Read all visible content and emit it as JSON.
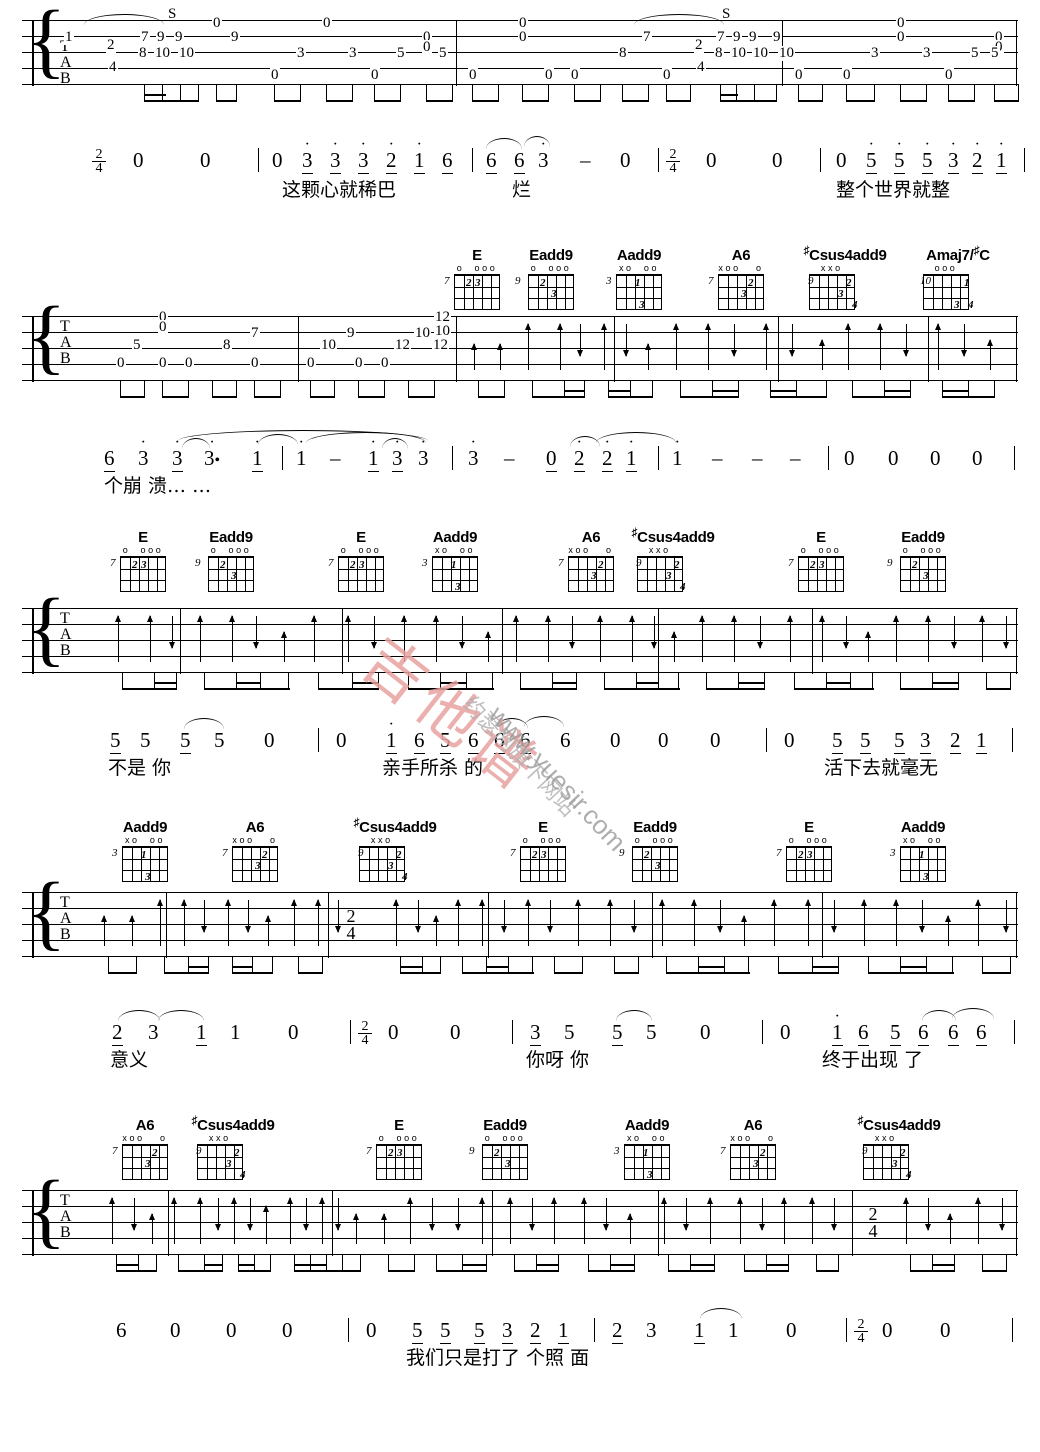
{
  "document": {
    "type": "guitar-tablature",
    "notation": "TAB + jianpu numbered notation with Chinese lyrics",
    "tab_letters": [
      "T",
      "A",
      "B"
    ]
  },
  "watermark": {
    "chinese": "吉他谱",
    "site_chinese": "约瑟网旗下网站",
    "url": "www.yuesir.com",
    "color_red": "#e8a3a0",
    "color_gray": "#9a9a9a"
  },
  "meter": {
    "num": "2",
    "den": "4"
  },
  "chord_names": {
    "E": "E",
    "Eadd9": "Eadd9",
    "Aadd9": "Aadd9",
    "A6": "A6",
    "Csus4add9": "Csus4add9",
    "Csus4add9_sharp": "♯",
    "Amaj7C": "Amaj7/",
    "Amaj7C_sharp": "♯",
    "Amaj7C_bass": "C"
  },
  "systems": [
    {
      "id": "system-1",
      "chords": [],
      "tab_numbers": [
        "1",
        "2",
        "7",
        "9",
        "9",
        "8",
        "10",
        "10",
        "0",
        "9",
        "4",
        "0",
        "0",
        "3",
        "0",
        "3",
        "0",
        "5",
        "0",
        "5",
        "0",
        "0",
        "8",
        "7",
        "0",
        "0",
        "0",
        "2",
        "7",
        "9",
        "9",
        "9",
        "8",
        "10",
        "10",
        "10",
        "0",
        "0",
        "0",
        "0",
        "3",
        "0",
        "3",
        "0",
        "5",
        "0",
        "5"
      ],
      "markings": [
        "S",
        "S"
      ],
      "jianpu": "2/4  0  0 | 0  3 3 3 2 1 6 | 6 6 3 - 0 | 2/4 0 0 | 0 5 5 5 3 2 1 |",
      "lyrics": [
        "这颗心就稀巴",
        "烂",
        "整个世界就整"
      ]
    },
    {
      "id": "system-2",
      "chords": [
        "E",
        "Eadd9",
        "Aadd9",
        "A6",
        "♯Csus4add9",
        "Amaj7/♯C"
      ],
      "tab_numbers": [
        "0",
        "0",
        "5",
        "7",
        "8",
        "0",
        "0",
        "10",
        "9",
        "0",
        "0",
        "12",
        "10",
        "10",
        "12",
        "12",
        "12",
        "0"
      ],
      "jianpu": "6 3 3 3· 1 | 1 - 1 3 3 | 3 - 0 2 2 1 | 1 - - - | 0 0 0 0 |",
      "lyrics": [
        "个崩 溃… …"
      ]
    },
    {
      "id": "system-3",
      "chords": [
        "E",
        "Eadd9",
        "E",
        "Aadd9",
        "A6",
        "♯Csus4add9",
        "E",
        "Eadd9"
      ],
      "tab_numbers": [],
      "jianpu": "5 5 5 5 0 | 0 1 6 5 6 6 6 | 6 0 0 0 | 0 5 5 5 3 2 1 |",
      "lyrics": [
        "不是 你",
        "亲手所杀 的",
        "活下去就毫无"
      ]
    },
    {
      "id": "system-4",
      "chords": [
        "Aadd9",
        "A6",
        "♯Csus4add9",
        "E",
        "Eadd9",
        "E",
        "Aadd9"
      ],
      "tab_numbers": [],
      "jianpu": "2 3 1 1 0 | 2/4 0 0 | 3 5 5 5 0 | 0 1 6 5 6 6 6 |",
      "lyrics": [
        "意义",
        "你呀 你",
        "终于出现 了"
      ]
    },
    {
      "id": "system-5",
      "chords": [
        "A6",
        "♯Csus4add9",
        "E",
        "Eadd9",
        "Aadd9",
        "A6",
        "♯Csus4add9"
      ],
      "tab_numbers": [],
      "jianpu": "6 0 0 0 | 0 5 5 5 3 2 1 | 2 3 1 1 0 | 2/4 0 0 |",
      "lyrics": [
        "我们只是打了 个照 面"
      ]
    }
  ],
  "chord_shapes": {
    "E": {
      "fret": "7",
      "top": "o  ooo",
      "dots": [
        {
          "s": 1,
          "f": 1,
          "n": "2"
        },
        {
          "s": 2,
          "f": 1,
          "n": "3"
        }
      ]
    },
    "Eadd9": {
      "fret": "9",
      "top": "o  ooo",
      "dots": [
        {
          "s": 0,
          "f": 1,
          "n": "2"
        },
        {
          "s": 2,
          "f": 2,
          "n": "3"
        }
      ]
    },
    "Aadd9": {
      "fret": "3",
      "top": "xo  oo",
      "dots": [
        {
          "s": 1,
          "f": 1,
          "n": "1"
        },
        {
          "s": 2,
          "f": 3,
          "n": "3"
        }
      ]
    },
    "A6": {
      "fret": "7",
      "top": "xoo   o",
      "dots": [
        {
          "s": 3,
          "f": 1,
          "n": "2"
        },
        {
          "s": 2,
          "f": 2,
          "n": "3"
        }
      ]
    },
    "Csus4add9": {
      "fret": "9",
      "top": "xxo",
      "dots": [
        {
          "s": 3,
          "f": 1,
          "n": "2"
        },
        {
          "s": 2,
          "f": 2,
          "n": "3"
        },
        {
          "s": 4,
          "f": 3,
          "n": "4"
        }
      ]
    },
    "Amaj7/C": {
      "fret": "10",
      "top": "ooo",
      "dots": [
        {
          "s": 3,
          "f": 1,
          "n": "1"
        },
        {
          "s": 2,
          "f": 3,
          "n": "3"
        },
        {
          "s": 4,
          "f": 3,
          "n": "4"
        }
      ]
    }
  },
  "lyrics_all": [
    "这颗心就稀巴",
    "烂",
    "整个世界就整",
    "个崩 溃… …",
    "不是 你",
    "亲手所杀 的",
    "活下去就毫无",
    "意义",
    "你呀 你",
    "终于出现 了",
    "我们只是打了 个照 面"
  ]
}
